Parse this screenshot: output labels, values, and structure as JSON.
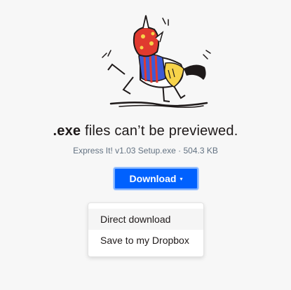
{
  "preview": {
    "headline_ext": ".exe",
    "headline_rest": "files can’t be previewed.",
    "file_info": "Express It! v1.03 Setup.exe · 504.3 KB"
  },
  "download": {
    "label": "Download",
    "caret_icon": "▾",
    "accent_color": "#0061fe"
  },
  "menu": {
    "items": [
      {
        "label": "Direct download"
      },
      {
        "label": "Save to my Dropbox"
      }
    ]
  },
  "illustration": {
    "icon": "unicorn-horse-illustration",
    "colors": {
      "red": "#e03a2f",
      "blue": "#3d5bd6",
      "yellow": "#f7d34a",
      "black": "#1e1919"
    }
  }
}
